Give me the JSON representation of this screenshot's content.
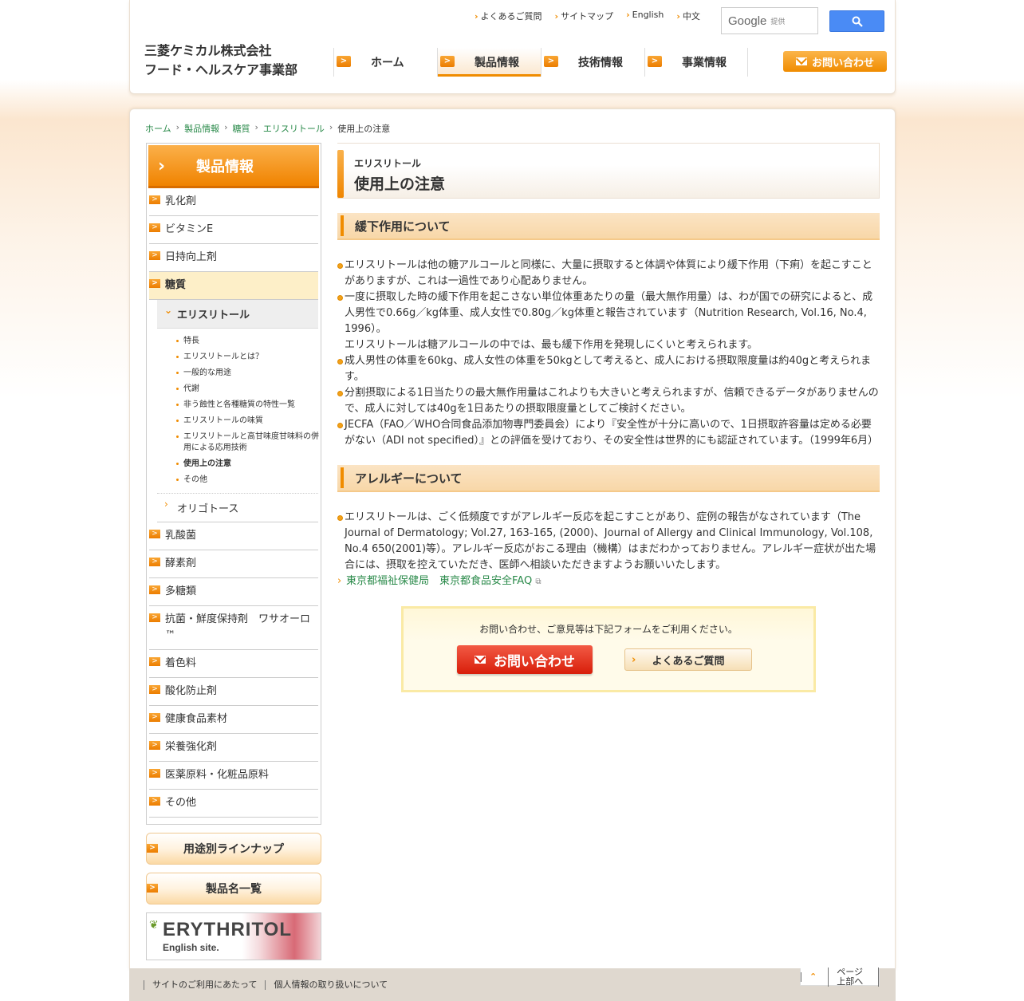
{
  "header": {
    "util_links": [
      "よくあるご質問",
      "サイトマップ",
      "English",
      "中文"
    ],
    "search": {
      "brand": "Google",
      "provided": "提供"
    },
    "company": "三菱ケミカル株式会社",
    "division": "フード・ヘルスケア事業部",
    "nav": [
      "ホーム",
      "製品情報",
      "技術情報",
      "事業情報"
    ],
    "contact_label": "お問い合わせ"
  },
  "breadcrumb": [
    "ホーム",
    "製品情報",
    "糖質",
    "エリスリトール",
    "使用上の注意"
  ],
  "sidebar": {
    "title": "製品情報",
    "items_top": [
      "乳化剤",
      "ビタミンE",
      "日持向上剤"
    ],
    "current": "糖質",
    "sub_current": "エリスリトール",
    "sub_pages": [
      "特長",
      "エリスリトールとは？",
      "一般的な用途",
      "代謝",
      "非う蝕性と各種糖質の特性一覧",
      "エリスリトールの味質",
      "エリスリトールと高甘味度甘味料の併用による応用技術",
      "使用上の注意",
      "その他"
    ],
    "sub_active": "使用上の注意",
    "sub_other": "オリゴトース",
    "items_bottom": [
      "乳酸菌",
      "酵素剤",
      "多糖類",
      "抗菌・鮮度保持剤　ワサオーロ™",
      "着色料",
      "酸化防止剤",
      "健康食品素材",
      "栄養強化剤",
      "医薬原料・化粧品原料",
      "その他"
    ],
    "btn_usage": "用途別ラインナップ",
    "btn_products": "製品名一覧",
    "banner_title": "ERYTHRITOL",
    "banner_sub": "English site."
  },
  "content": {
    "title_sub": "エリスリトール",
    "title_main": "使用上の注意",
    "section1": {
      "heading": "緩下作用について",
      "paras": [
        "エリスリトールは他の糖アルコールと同様に、大量に摂取すると体調や体質により緩下作用（下痢）を起こすことがありますが、これは一過性であり心配ありません。",
        "一度に摂取した時の緩下作用を起こさない単位体重あたりの量（最大無作用量）は、わが国での研究によると、成人男性で0.66g／kg体重、成人女性で0.80g／kg体重と報告されています（Nutrition Research, Vol.16, No.4, 1996）。",
        "エリスリトールは糖アルコールの中では、最も緩下作用を発現しにくいと考えられます。",
        "成人男性の体重を60kg、成人女性の体重を50kgとして考えると、成人における摂取限度量は約40gと考えられます。",
        "分割摂取による1日当たりの最大無作用量はこれよりも大きいと考えられますが、信頼できるデータがありませんので、成人に対しては40gを1日あたりの摂取限度量としてご検討ください。",
        "JECFA（FAO／WHO合同食品添加物専門委員会）により『安全性が十分に高いので、1日摂取許容量は定める必要がない（ADI not specified）』との評価を受けており、その安全性は世界的にも認証されています。（1999年6月）"
      ]
    },
    "section2": {
      "heading": "アレルギーについて",
      "para": "エリスリトールは、ごく低頻度ですがアレルギー反応を起こすことがあり、症例の報告がなされています（The Journal of Dermatology; Vol.27, 163-165, (2000)、Journal of Allergy and Clinical Immunology, Vol.108, No.4 650(2001)等）。アレルギー反応がおこる理由（機構）はまだわかっておりません。アレルギー症状が出た場合には、摂取を控えていただき、医師へ相談いただきますようお願いいたします。",
      "link": "東京都福祉保健局　東京都食品安全FAQ"
    },
    "contact_panel": {
      "message": "お問い合わせ、ご意見等は下記フォームをご利用ください。",
      "contact_btn": "お問い合わせ",
      "faq_btn": "よくあるご質問"
    }
  },
  "footer": {
    "links": [
      "サイトのご利用にあたって",
      "個人情報の取り扱いについて"
    ],
    "pagetop": "ページ上部へ"
  },
  "colors": {
    "accent": "#f08c00",
    "link": "#2a8a4a",
    "contact_red": "#d81e0a"
  }
}
